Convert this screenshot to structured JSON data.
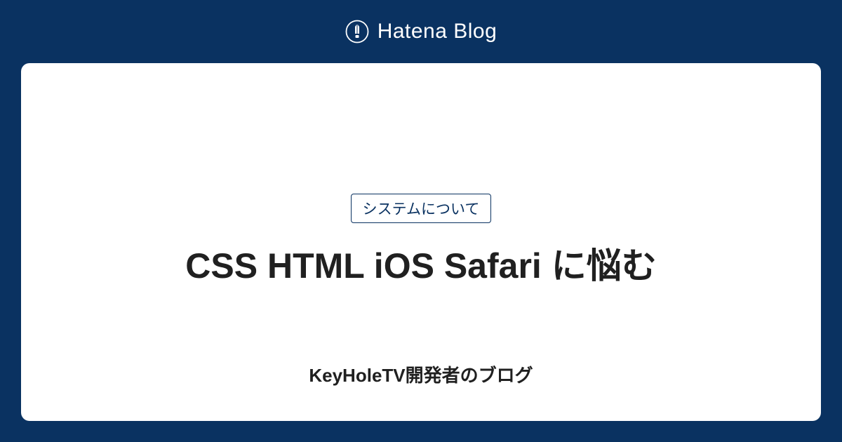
{
  "header": {
    "logo_text": "Hatena Blog"
  },
  "card": {
    "category": "システムについて",
    "title": "CSS HTML iOS Safari に悩む",
    "author": "KeyHoleTV開発者のブログ"
  },
  "colors": {
    "background": "#0a3261",
    "card_bg": "#ffffff",
    "text": "#202020"
  }
}
